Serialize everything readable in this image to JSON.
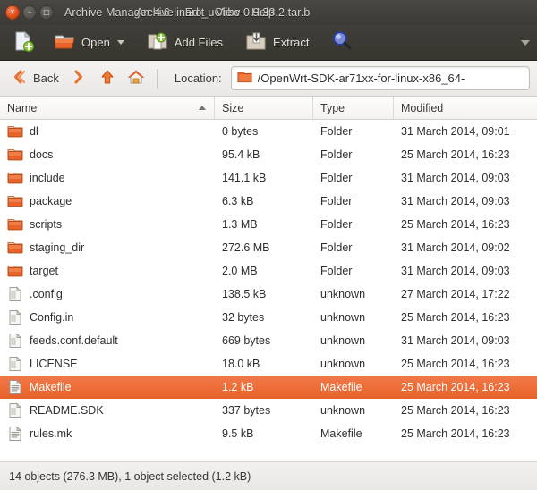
{
  "window": {
    "title": "Archive Manager",
    "archive_name": "-4.6-linaro_uClibc-0.9.33.2.tar.b",
    "controls": {
      "close": "close-button",
      "minimize": "minimize-button",
      "maximize": "maximize-button",
      "minimize_glyph": "–",
      "maximize_glyph": "□"
    }
  },
  "menubar": {
    "items": [
      {
        "label": "Archive"
      },
      {
        "label": "Edit"
      },
      {
        "label": "View"
      },
      {
        "label": "Help"
      }
    ]
  },
  "toolbar": {
    "new_label": "",
    "open_label": "Open",
    "add_files_label": "Add Files",
    "extract_label": "Extract",
    "search_label": ""
  },
  "locationbar": {
    "back_label": "Back",
    "location_label": "Location:",
    "path": "/OpenWrt-SDK-ar71xx-for-linux-x86_64-"
  },
  "columns": {
    "name": "Name",
    "size": "Size",
    "type": "Type",
    "modified": "Modified",
    "sorted_by": "Name",
    "sort_direction": "ascending"
  },
  "colors": {
    "selection": "#e8622a",
    "folder_icon": "#e8622a",
    "titlebar": "#3b3a36",
    "toolbar": "#37362f",
    "close_button": "#df4b14"
  },
  "files": [
    {
      "icon": "folder-icon",
      "name": "dl",
      "size": "0 bytes",
      "type": "Folder",
      "modified": "31 March 2014, 09:01",
      "selected": false
    },
    {
      "icon": "folder-icon",
      "name": "docs",
      "size": "95.4 kB",
      "type": "Folder",
      "modified": "25 March 2014, 16:23",
      "selected": false
    },
    {
      "icon": "folder-icon",
      "name": "include",
      "size": "141.1 kB",
      "type": "Folder",
      "modified": "31 March 2014, 09:03",
      "selected": false
    },
    {
      "icon": "folder-icon",
      "name": "package",
      "size": "6.3 kB",
      "type": "Folder",
      "modified": "31 March 2014, 09:03",
      "selected": false
    },
    {
      "icon": "folder-icon",
      "name": "scripts",
      "size": "1.3 MB",
      "type": "Folder",
      "modified": "25 March 2014, 16:23",
      "selected": false
    },
    {
      "icon": "folder-icon",
      "name": "staging_dir",
      "size": "272.6 MB",
      "type": "Folder",
      "modified": "31 March 2014, 09:02",
      "selected": false
    },
    {
      "icon": "folder-icon",
      "name": "target",
      "size": "2.0 MB",
      "type": "Folder",
      "modified": "31 March 2014, 09:03",
      "selected": false
    },
    {
      "icon": "file-icon",
      "name": ".config",
      "size": "138.5 kB",
      "type": "unknown",
      "modified": "27 March 2014, 17:22",
      "selected": false
    },
    {
      "icon": "file-icon",
      "name": "Config.in",
      "size": "32 bytes",
      "type": "unknown",
      "modified": "25 March 2014, 16:23",
      "selected": false
    },
    {
      "icon": "file-icon",
      "name": "feeds.conf.default",
      "size": "669 bytes",
      "type": "unknown",
      "modified": "31 March 2014, 09:03",
      "selected": false
    },
    {
      "icon": "file-icon",
      "name": "LICENSE",
      "size": "18.0 kB",
      "type": "unknown",
      "modified": "25 March 2014, 16:23",
      "selected": false
    },
    {
      "icon": "makefile-icon",
      "name": "Makefile",
      "size": "1.2 kB",
      "type": "Makefile",
      "modified": "25 March 2014, 16:23",
      "selected": true
    },
    {
      "icon": "file-icon",
      "name": "README.SDK",
      "size": "337 bytes",
      "type": "unknown",
      "modified": "25 March 2014, 16:23",
      "selected": false
    },
    {
      "icon": "makefile-icon",
      "name": "rules.mk",
      "size": "9.5 kB",
      "type": "Makefile",
      "modified": "25 March 2014, 16:23",
      "selected": false
    }
  ],
  "statusbar": {
    "text": "14 objects (276.3 MB), 1 object selected (1.2 kB)"
  }
}
